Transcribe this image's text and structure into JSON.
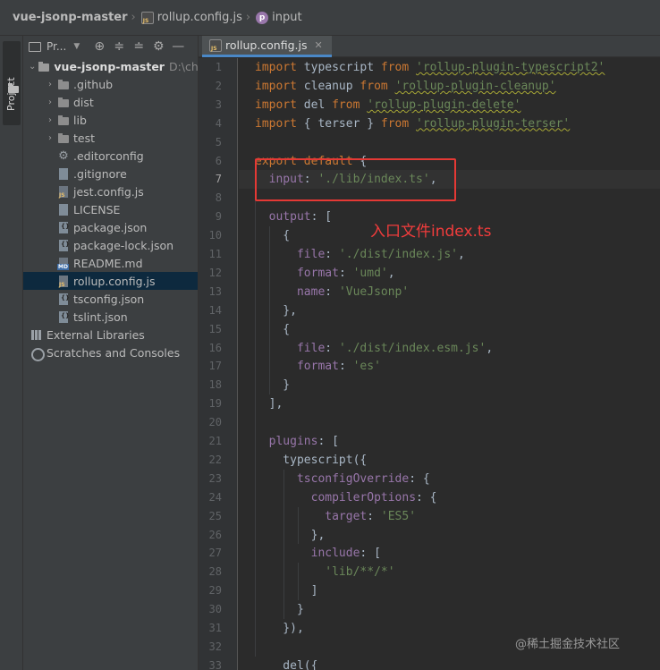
{
  "breadcrumbs": [
    {
      "label": "vue-jsonp-master",
      "icon": null
    },
    {
      "label": "rollup.config.js",
      "icon": "js-file-icon"
    },
    {
      "label": "input",
      "icon": "property-icon"
    }
  ],
  "left_strip": {
    "label": "Project"
  },
  "project_panel": {
    "header_label": "Pr...",
    "tree": [
      {
        "label": "vue-jsonp-master",
        "hint": "D:\\chro",
        "icon": "folder-icon",
        "level": 0,
        "arrow": "open",
        "root": true
      },
      {
        "label": ".github",
        "icon": "folder-icon",
        "level": 1,
        "arrow": "closed"
      },
      {
        "label": "dist",
        "icon": "folder-icon",
        "level": 1,
        "arrow": "closed"
      },
      {
        "label": "lib",
        "icon": "folder-icon",
        "level": 1,
        "arrow": "closed"
      },
      {
        "label": "test",
        "icon": "folder-icon",
        "level": 1,
        "arrow": "closed"
      },
      {
        "label": ".editorconfig",
        "icon": "gear-icon",
        "level": 1
      },
      {
        "label": ".gitignore",
        "icon": "doc-icon",
        "level": 1
      },
      {
        "label": "jest.config.js",
        "icon": "js-file-icon",
        "level": 1
      },
      {
        "label": "LICENSE",
        "icon": "doc-icon",
        "level": 1
      },
      {
        "label": "package.json",
        "icon": "json-file-icon",
        "level": 1
      },
      {
        "label": "package-lock.json",
        "icon": "json-file-icon",
        "level": 1
      },
      {
        "label": "README.md",
        "icon": "md-file-icon",
        "level": 1
      },
      {
        "label": "rollup.config.js",
        "icon": "js-file-icon",
        "level": 1,
        "selected": true
      },
      {
        "label": "tsconfig.json",
        "icon": "json-file-icon",
        "level": 1
      },
      {
        "label": "tslint.json",
        "icon": "json-file-icon",
        "level": 1
      },
      {
        "label": "External Libraries",
        "icon": "library-icon",
        "level": 0
      },
      {
        "label": "Scratches and Consoles",
        "icon": "scratch-icon",
        "level": 0
      }
    ]
  },
  "editor": {
    "tab_label": "rollup.config.js",
    "active_line": 7,
    "lines": [
      {
        "n": "1",
        "tokens": [
          [
            "kw",
            "import"
          ],
          [
            "t",
            " typescript "
          ],
          [
            "kw",
            "from"
          ],
          [
            "t",
            " "
          ],
          [
            "strsq",
            "'rollup-plugin-typescript2'"
          ]
        ]
      },
      {
        "n": "2",
        "tokens": [
          [
            "kw",
            "import"
          ],
          [
            "t",
            " cleanup "
          ],
          [
            "kw",
            "from"
          ],
          [
            "t",
            " "
          ],
          [
            "strsq",
            "'rollup-plugin-cleanup'"
          ]
        ]
      },
      {
        "n": "3",
        "tokens": [
          [
            "kw",
            "import"
          ],
          [
            "t",
            " del "
          ],
          [
            "kw",
            "from"
          ],
          [
            "t",
            " "
          ],
          [
            "strsq",
            "'rollup-plugin-delete'"
          ]
        ]
      },
      {
        "n": "4",
        "tokens": [
          [
            "kw",
            "import"
          ],
          [
            "t",
            " { terser } "
          ],
          [
            "kw",
            "from"
          ],
          [
            "t",
            " "
          ],
          [
            "strsq",
            "'rollup-plugin-terser'"
          ]
        ]
      },
      {
        "n": "5",
        "tokens": []
      },
      {
        "n": "6",
        "tokens": [
          [
            "kw",
            "export default"
          ],
          [
            "t",
            " {"
          ]
        ]
      },
      {
        "n": "7",
        "tokens": [
          [
            "t",
            "  "
          ],
          [
            "prop",
            "input"
          ],
          [
            "t",
            ": "
          ],
          [
            "str",
            "'./lib/index.ts'"
          ],
          [
            "t",
            ","
          ]
        ]
      },
      {
        "n": "8",
        "tokens": []
      },
      {
        "n": "9",
        "tokens": [
          [
            "t",
            "  "
          ],
          [
            "prop",
            "output"
          ],
          [
            "t",
            ": ["
          ]
        ]
      },
      {
        "n": "10",
        "tokens": [
          [
            "t",
            "    {"
          ]
        ]
      },
      {
        "n": "11",
        "tokens": [
          [
            "t",
            "      "
          ],
          [
            "prop",
            "file"
          ],
          [
            "t",
            ": "
          ],
          [
            "str",
            "'./dist/index.js'"
          ],
          [
            "t",
            ","
          ]
        ]
      },
      {
        "n": "12",
        "tokens": [
          [
            "t",
            "      "
          ],
          [
            "prop",
            "format"
          ],
          [
            "t",
            ": "
          ],
          [
            "str",
            "'umd'"
          ],
          [
            "t",
            ","
          ]
        ]
      },
      {
        "n": "13",
        "tokens": [
          [
            "t",
            "      "
          ],
          [
            "prop",
            "name"
          ],
          [
            "t",
            ": "
          ],
          [
            "str",
            "'VueJsonp'"
          ]
        ]
      },
      {
        "n": "14",
        "tokens": [
          [
            "t",
            "    },"
          ]
        ]
      },
      {
        "n": "15",
        "tokens": [
          [
            "t",
            "    {"
          ]
        ]
      },
      {
        "n": "16",
        "tokens": [
          [
            "t",
            "      "
          ],
          [
            "prop",
            "file"
          ],
          [
            "t",
            ": "
          ],
          [
            "str",
            "'./dist/index.esm.js'"
          ],
          [
            "t",
            ","
          ]
        ]
      },
      {
        "n": "17",
        "tokens": [
          [
            "t",
            "      "
          ],
          [
            "prop",
            "format"
          ],
          [
            "t",
            ": "
          ],
          [
            "str",
            "'es'"
          ]
        ]
      },
      {
        "n": "18",
        "tokens": [
          [
            "t",
            "    }"
          ]
        ]
      },
      {
        "n": "19",
        "tokens": [
          [
            "t",
            "  ],"
          ]
        ]
      },
      {
        "n": "20",
        "tokens": []
      },
      {
        "n": "21",
        "tokens": [
          [
            "t",
            "  "
          ],
          [
            "prop",
            "plugins"
          ],
          [
            "t",
            ": ["
          ]
        ]
      },
      {
        "n": "22",
        "tokens": [
          [
            "t",
            "    typescript({"
          ]
        ]
      },
      {
        "n": "23",
        "tokens": [
          [
            "t",
            "      "
          ],
          [
            "prop",
            "tsconfigOverride"
          ],
          [
            "t",
            ": {"
          ]
        ]
      },
      {
        "n": "24",
        "tokens": [
          [
            "t",
            "        "
          ],
          [
            "prop",
            "compilerOptions"
          ],
          [
            "t",
            ": {"
          ]
        ]
      },
      {
        "n": "25",
        "tokens": [
          [
            "t",
            "          "
          ],
          [
            "prop",
            "target"
          ],
          [
            "t",
            ": "
          ],
          [
            "str",
            "'ES5'"
          ]
        ]
      },
      {
        "n": "26",
        "tokens": [
          [
            "t",
            "        },"
          ]
        ]
      },
      {
        "n": "27",
        "tokens": [
          [
            "t",
            "        "
          ],
          [
            "prop",
            "include"
          ],
          [
            "t",
            ": ["
          ]
        ]
      },
      {
        "n": "28",
        "tokens": [
          [
            "t",
            "          "
          ],
          [
            "str",
            "'lib/**/*'"
          ]
        ]
      },
      {
        "n": "29",
        "tokens": [
          [
            "t",
            "        ]"
          ]
        ]
      },
      {
        "n": "30",
        "tokens": [
          [
            "t",
            "      }"
          ]
        ]
      },
      {
        "n": "31",
        "tokens": [
          [
            "t",
            "    }),"
          ]
        ]
      },
      {
        "n": "32",
        "tokens": []
      },
      {
        "n": "33",
        "tokens": [
          [
            "t",
            "    del({"
          ]
        ]
      }
    ]
  },
  "annotation": {
    "text": "入口文件index.ts",
    "color": "#f23c3c"
  },
  "watermark": "@稀土掘金技术社区",
  "colors": {
    "keyword": "#cc7832",
    "string": "#6a8759",
    "property": "#9876aa",
    "text": "#a9b7c6",
    "selection": "#0d293e",
    "highlight_box": "#e53935"
  }
}
